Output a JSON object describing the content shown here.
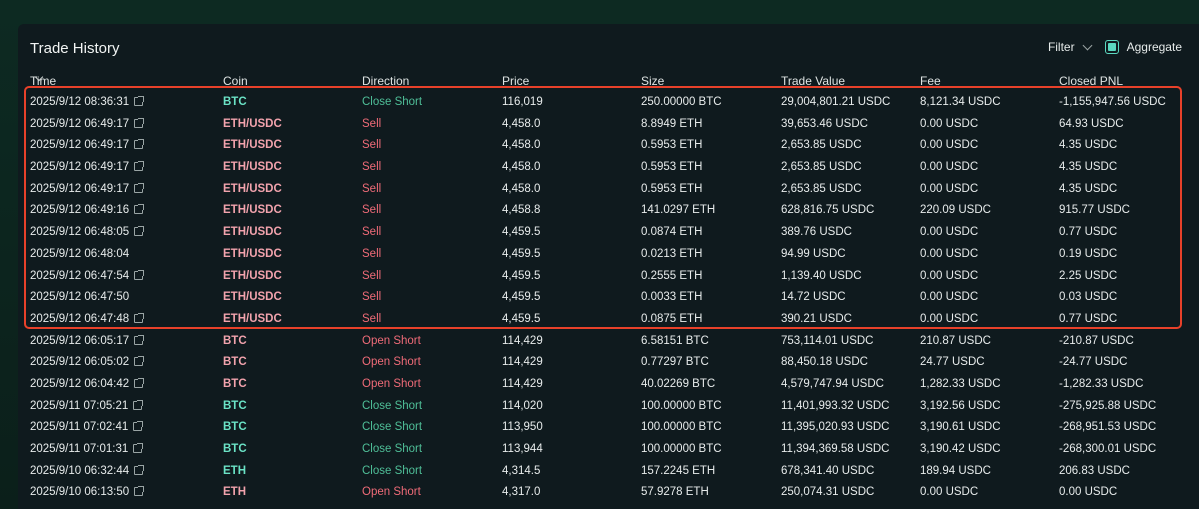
{
  "panel": {
    "title": "Trade History",
    "filter_label": "Filter",
    "aggregate_label": "Aggregate",
    "aggregate_checked": true
  },
  "columns": [
    "Time",
    "Coin",
    "Direction",
    "Price",
    "Size",
    "Trade Value",
    "Fee",
    "Closed PNL"
  ],
  "colors": {
    "accent": "#5bd8c0",
    "long_green": "#4fbf98",
    "short_red": "#ef6b78",
    "highlight": "#e8412a"
  },
  "rows": [
    {
      "time": "2025/9/12 08:36:31",
      "link": true,
      "coin": "BTC",
      "coin_color": "green",
      "dir": "Close Short",
      "dir_color": "green",
      "price": "116,019",
      "size": "250.00000 BTC",
      "value": "29,004,801.21 USDC",
      "fee": "8,121.34 USDC",
      "pnl": "-1,155,947.56 USDC"
    },
    {
      "time": "2025/9/12 06:49:17",
      "link": true,
      "coin": "ETH/USDC",
      "coin_color": "red",
      "dir": "Sell",
      "dir_color": "red",
      "price": "4,458.0",
      "size": "8.8949 ETH",
      "value": "39,653.46 USDC",
      "fee": "0.00 USDC",
      "pnl": "64.93 USDC"
    },
    {
      "time": "2025/9/12 06:49:17",
      "link": true,
      "coin": "ETH/USDC",
      "coin_color": "red",
      "dir": "Sell",
      "dir_color": "red",
      "price": "4,458.0",
      "size": "0.5953 ETH",
      "value": "2,653.85 USDC",
      "fee": "0.00 USDC",
      "pnl": "4.35 USDC"
    },
    {
      "time": "2025/9/12 06:49:17",
      "link": true,
      "coin": "ETH/USDC",
      "coin_color": "red",
      "dir": "Sell",
      "dir_color": "red",
      "price": "4,458.0",
      "size": "0.5953 ETH",
      "value": "2,653.85 USDC",
      "fee": "0.00 USDC",
      "pnl": "4.35 USDC"
    },
    {
      "time": "2025/9/12 06:49:17",
      "link": true,
      "coin": "ETH/USDC",
      "coin_color": "red",
      "dir": "Sell",
      "dir_color": "red",
      "price": "4,458.0",
      "size": "0.5953 ETH",
      "value": "2,653.85 USDC",
      "fee": "0.00 USDC",
      "pnl": "4.35 USDC"
    },
    {
      "time": "2025/9/12 06:49:16",
      "link": true,
      "coin": "ETH/USDC",
      "coin_color": "red",
      "dir": "Sell",
      "dir_color": "red",
      "price": "4,458.8",
      "size": "141.0297 ETH",
      "value": "628,816.75 USDC",
      "fee": "220.09 USDC",
      "pnl": "915.77 USDC"
    },
    {
      "time": "2025/9/12 06:48:05",
      "link": true,
      "coin": "ETH/USDC",
      "coin_color": "red",
      "dir": "Sell",
      "dir_color": "red",
      "price": "4,459.5",
      "size": "0.0874 ETH",
      "value": "389.76 USDC",
      "fee": "0.00 USDC",
      "pnl": "0.77 USDC"
    },
    {
      "time": "2025/9/12 06:48:04",
      "link": false,
      "coin": "ETH/USDC",
      "coin_color": "red",
      "dir": "Sell",
      "dir_color": "red",
      "price": "4,459.5",
      "size": "0.0213 ETH",
      "value": "94.99 USDC",
      "fee": "0.00 USDC",
      "pnl": "0.19 USDC"
    },
    {
      "time": "2025/9/12 06:47:54",
      "link": true,
      "coin": "ETH/USDC",
      "coin_color": "red",
      "dir": "Sell",
      "dir_color": "red",
      "price": "4,459.5",
      "size": "0.2555 ETH",
      "value": "1,139.40 USDC",
      "fee": "0.00 USDC",
      "pnl": "2.25 USDC"
    },
    {
      "time": "2025/9/12 06:47:50",
      "link": false,
      "coin": "ETH/USDC",
      "coin_color": "red",
      "dir": "Sell",
      "dir_color": "red",
      "price": "4,459.5",
      "size": "0.0033 ETH",
      "value": "14.72 USDC",
      "fee": "0.00 USDC",
      "pnl": "0.03 USDC"
    },
    {
      "time": "2025/9/12 06:47:48",
      "link": true,
      "coin": "ETH/USDC",
      "coin_color": "red",
      "dir": "Sell",
      "dir_color": "red",
      "price": "4,459.5",
      "size": "0.0875 ETH",
      "value": "390.21 USDC",
      "fee": "0.00 USDC",
      "pnl": "0.77 USDC"
    },
    {
      "time": "2025/9/12 06:05:17",
      "link": true,
      "coin": "BTC",
      "coin_color": "red",
      "dir": "Open Short",
      "dir_color": "red",
      "price": "114,429",
      "size": "6.58151 BTC",
      "value": "753,114.01 USDC",
      "fee": "210.87 USDC",
      "pnl": "-210.87 USDC"
    },
    {
      "time": "2025/9/12 06:05:02",
      "link": true,
      "coin": "BTC",
      "coin_color": "red",
      "dir": "Open Short",
      "dir_color": "red",
      "price": "114,429",
      "size": "0.77297 BTC",
      "value": "88,450.18 USDC",
      "fee": "24.77 USDC",
      "pnl": "-24.77 USDC"
    },
    {
      "time": "2025/9/12 06:04:42",
      "link": true,
      "coin": "BTC",
      "coin_color": "red",
      "dir": "Open Short",
      "dir_color": "red",
      "price": "114,429",
      "size": "40.02269 BTC",
      "value": "4,579,747.94 USDC",
      "fee": "1,282.33 USDC",
      "pnl": "-1,282.33 USDC"
    },
    {
      "time": "2025/9/11 07:05:21",
      "link": true,
      "coin": "BTC",
      "coin_color": "green",
      "dir": "Close Short",
      "dir_color": "green",
      "price": "114,020",
      "size": "100.00000 BTC",
      "value": "11,401,993.32 USDC",
      "fee": "3,192.56 USDC",
      "pnl": "-275,925.88 USDC"
    },
    {
      "time": "2025/9/11 07:02:41",
      "link": true,
      "coin": "BTC",
      "coin_color": "green",
      "dir": "Close Short",
      "dir_color": "green",
      "price": "113,950",
      "size": "100.00000 BTC",
      "value": "11,395,020.93 USDC",
      "fee": "3,190.61 USDC",
      "pnl": "-268,951.53 USDC"
    },
    {
      "time": "2025/9/11 07:01:31",
      "link": true,
      "coin": "BTC",
      "coin_color": "green",
      "dir": "Close Short",
      "dir_color": "green",
      "price": "113,944",
      "size": "100.00000 BTC",
      "value": "11,394,369.58 USDC",
      "fee": "3,190.42 USDC",
      "pnl": "-268,300.01 USDC"
    },
    {
      "time": "2025/9/10 06:32:44",
      "link": true,
      "coin": "ETH",
      "coin_color": "green",
      "dir": "Close Short",
      "dir_color": "green",
      "price": "4,314.5",
      "size": "157.2245 ETH",
      "value": "678,341.40 USDC",
      "fee": "189.94 USDC",
      "pnl": "206.83 USDC"
    },
    {
      "time": "2025/9/10 06:13:50",
      "link": true,
      "coin": "ETH",
      "coin_color": "red",
      "dir": "Open Short",
      "dir_color": "red",
      "price": "4,317.0",
      "size": "57.9278 ETH",
      "value": "250,074.31 USDC",
      "fee": "0.00 USDC",
      "pnl": "0.00 USDC"
    }
  ]
}
